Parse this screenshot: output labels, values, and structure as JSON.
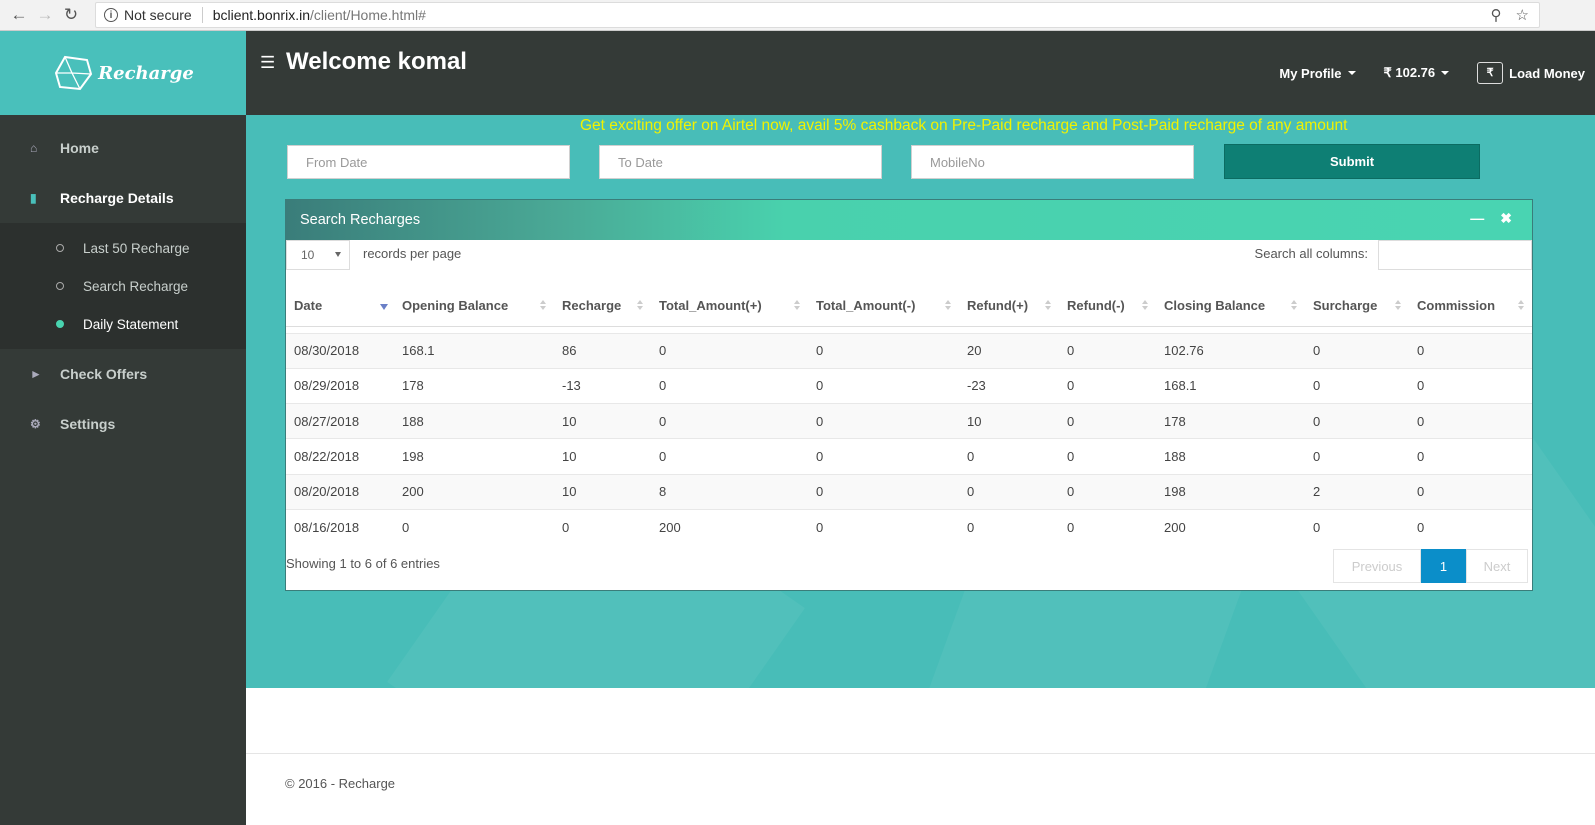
{
  "browser": {
    "security": "Not secure",
    "url_host": "bclient.bonrix.in",
    "url_path": "/client/Home.html#"
  },
  "sidebar": {
    "logo_text": "Recharge",
    "items": [
      {
        "label": "Home",
        "icon": "home-icon"
      },
      {
        "label": "Recharge Details",
        "icon": "book-icon"
      },
      {
        "label": "Check Offers",
        "icon": "megaphone-icon"
      },
      {
        "label": "Settings",
        "icon": "cogs-icon"
      }
    ],
    "sub_items": [
      {
        "label": "Last 50 Recharge"
      },
      {
        "label": "Search Recharge"
      },
      {
        "label": "Daily Statement"
      }
    ]
  },
  "header": {
    "welcome": "Welcome komal",
    "my_profile": "My Profile",
    "balance": "₹ 102.76",
    "load_money": "Load Money"
  },
  "promo": "Get exciting offer on Airtel now, avail 5% cashback on Pre-Paid recharge and Post-Paid recharge of any amount",
  "filters": {
    "from_date_placeholder": "From Date",
    "to_date_placeholder": "To Date",
    "mobile_placeholder": "MobileNo",
    "submit_label": "Submit"
  },
  "panel": {
    "title": "Search Recharges",
    "records_per_page_value": "10",
    "records_per_page_label": "records per page",
    "search_label": "Search all columns:",
    "columns": [
      "Date",
      "Opening Balance",
      "Recharge",
      "Total_Amount(+)",
      "Total_Amount(-)",
      "Refund(+)",
      "Refund(-)",
      "Closing Balance",
      "Surcharge",
      "Commission"
    ],
    "rows": [
      [
        "08/30/2018",
        "168.1",
        "86",
        "0",
        "0",
        "20",
        "0",
        "102.76",
        "0",
        "0"
      ],
      [
        "08/29/2018",
        "178",
        "-13",
        "0",
        "0",
        "-23",
        "0",
        "168.1",
        "0",
        "0"
      ],
      [
        "08/27/2018",
        "188",
        "10",
        "0",
        "0",
        "10",
        "0",
        "178",
        "0",
        "0"
      ],
      [
        "08/22/2018",
        "198",
        "10",
        "0",
        "0",
        "0",
        "0",
        "188",
        "0",
        "0"
      ],
      [
        "08/20/2018",
        "200",
        "10",
        "8",
        "0",
        "0",
        "0",
        "198",
        "2",
        "0"
      ],
      [
        "08/16/2018",
        "0",
        "0",
        "200",
        "0",
        "0",
        "0",
        "200",
        "0",
        "0"
      ]
    ],
    "showing": "Showing 1 to 6 of 6 entries",
    "pager": {
      "previous": "Previous",
      "current": "1",
      "next": "Next"
    }
  },
  "footer": "© 2016 - Recharge"
}
